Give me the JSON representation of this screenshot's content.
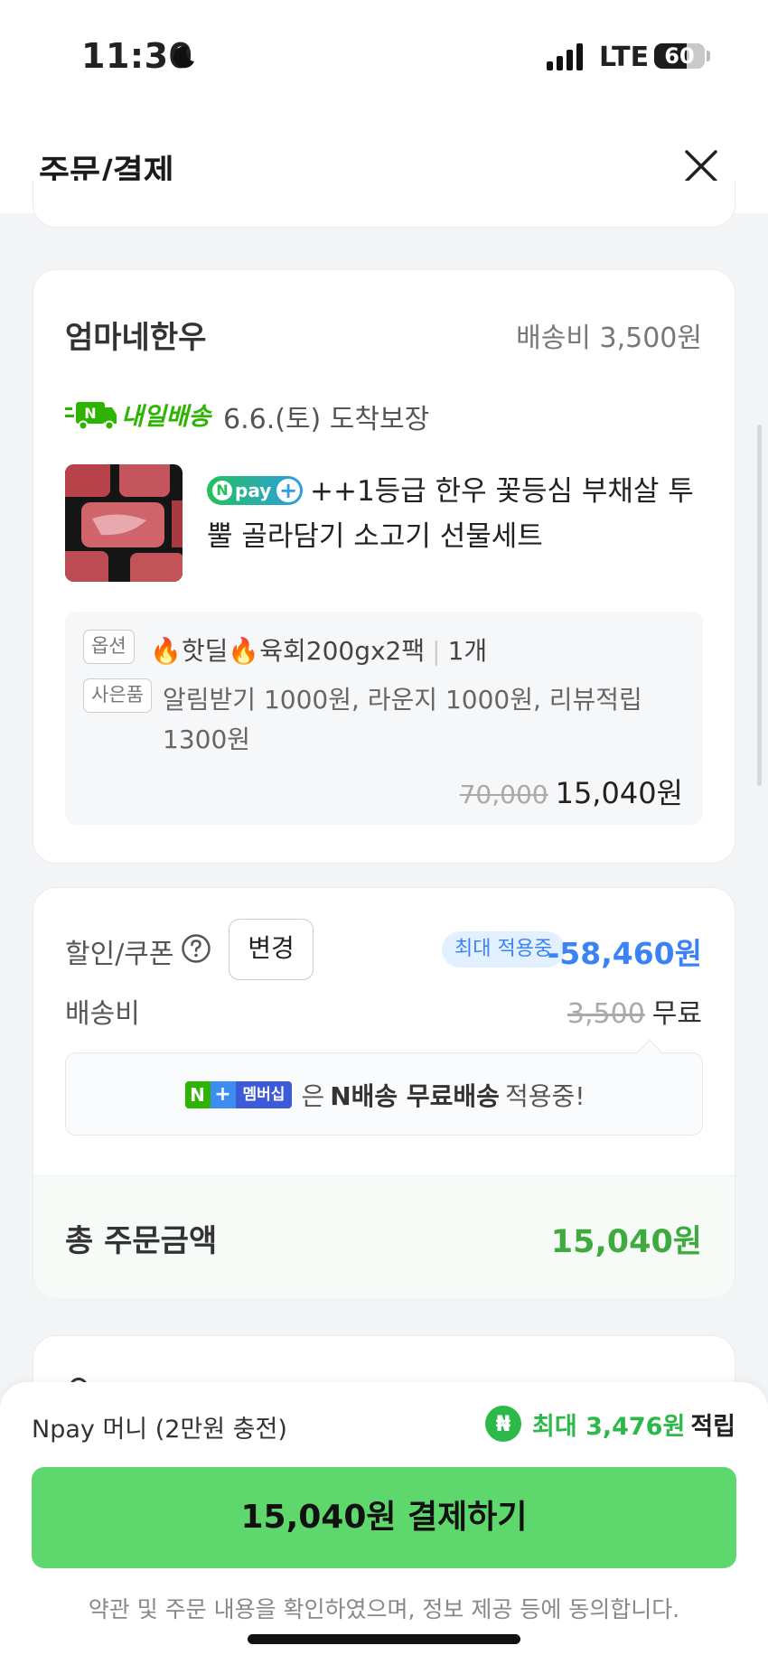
{
  "status_bar": {
    "time": "11:30",
    "network": "LTE",
    "battery": "60"
  },
  "header": {
    "title": "주문/결제"
  },
  "seller_card": {
    "seller_name": "엄마네한우",
    "shipping_fee": "배송비 3,500원",
    "nship_label": "내일배송",
    "arrival": "6.6.(토) 도착보장",
    "npay_badge": "pay",
    "product_name": "++1등급 한우 꽃등심 부채살 투뿔 골라담기 소고기 선물세트",
    "option_tag": "옵션",
    "option_text_1": "🔥핫딜🔥육회200gx2팩",
    "option_qty": "1개",
    "gift_tag": "사은품",
    "gift_text": "알림받기 1000원, 라운지 1000원, 리뷰적립 1300원",
    "original_price": "70,000",
    "price": "15,040원"
  },
  "discount_card": {
    "discount_label": "할인/쿠폰",
    "change_button": "변경",
    "max_badge": "최대 적용중",
    "discount_amount": "-58,460원",
    "shipping_label": "배송비",
    "shipping_original": "3,500",
    "shipping_value": "무료",
    "membership_badge": "멤버십",
    "membership_text_1": "은",
    "membership_bold": "N배송 무료배송",
    "membership_text_2": "적용중!",
    "total_label": "총 주문금액",
    "total_amount": "15,040원"
  },
  "bottom": {
    "npay_money": "Npay 머니 (2만원 충전)",
    "reward_prefix": "최대 3,476원",
    "reward_suffix": "적립",
    "pay_button": "15,040원 결제하기",
    "agree_text": "약관 및 주문 내용을 확인하였으며, 정보 제공 등에 동의합니다."
  },
  "colors": {
    "green": "#2db400",
    "pay_button": "#5ed86c",
    "discount_blue": "#3b82f6"
  }
}
